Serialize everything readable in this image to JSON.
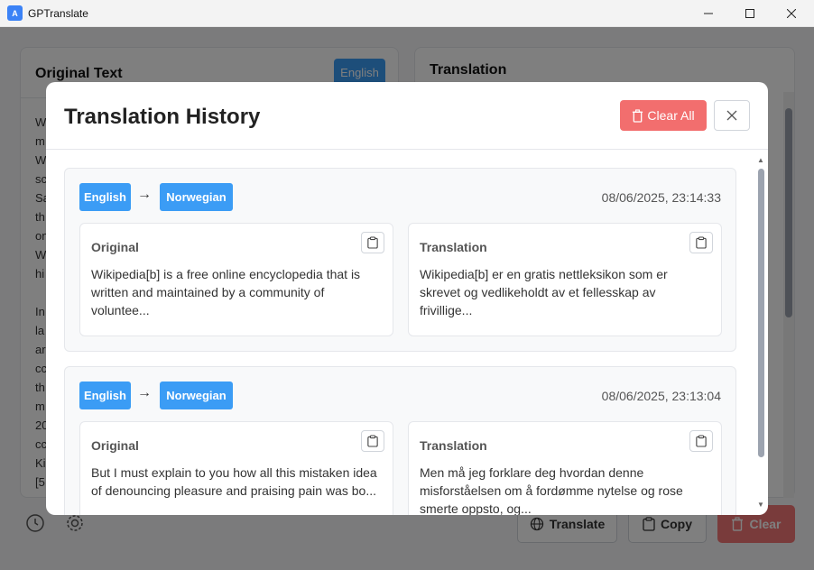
{
  "window": {
    "title": "GPTranslate"
  },
  "main": {
    "original_title": "Original Text",
    "source_language": "English",
    "source_text": "W\nm\nW\nsc\nSa\nth\non\nW\nhi\n\nIn\nla\nar\ncc\nth\nm\n20\ncc\nKi\n[5",
    "translation_title": "Translation"
  },
  "toolbar": {
    "translate_label": "Translate",
    "copy_label": "Copy",
    "clear_label": "Clear"
  },
  "modal": {
    "title": "Translation History",
    "clear_all_label": "Clear All",
    "entries": [
      {
        "from": "English",
        "to": "Norwegian",
        "timestamp": "08/06/2025, 23:14:33",
        "original_label": "Original",
        "original_text": "Wikipedia[b] is a free online encyclopedia that is written and maintained by a community of voluntee...",
        "translation_label": "Translation",
        "translation_text": "Wikipedia[b] er en gratis nettleksikon som er skrevet og vedlikeholdt av et fellesskap av frivillige..."
      },
      {
        "from": "English",
        "to": "Norwegian",
        "timestamp": "08/06/2025, 23:13:04",
        "original_label": "Original",
        "original_text": "But I must explain to you how all this mistaken idea of denouncing pleasure and praising pain was bo...",
        "translation_label": "Translation",
        "translation_text": "Men må jeg forklare deg hvordan denne misforståelsen om å fordømme nytelse og rose smerte oppsto, og..."
      }
    ]
  },
  "colors": {
    "accent": "#3b9cf5",
    "danger": "#f26e6e"
  },
  "icons": {
    "history": "clock-icon",
    "settings": "gear-icon",
    "translate": "globe-icon",
    "copy": "clipboard-icon",
    "clear": "trash-icon",
    "close": "close-icon"
  }
}
